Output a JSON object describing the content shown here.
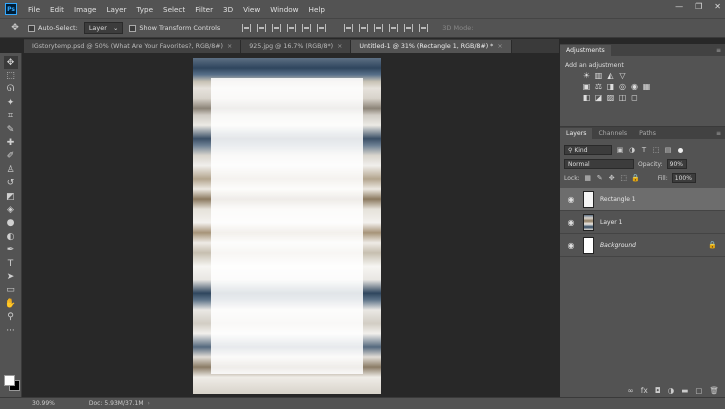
{
  "menubar": {
    "logo": "Ps",
    "items": [
      "File",
      "Edit",
      "Image",
      "Layer",
      "Type",
      "Select",
      "Filter",
      "3D",
      "View",
      "Window",
      "Help"
    ],
    "window_controls": [
      "—",
      "❐",
      "✕"
    ]
  },
  "options": {
    "auto_select_label": "Auto-Select:",
    "auto_select_value": "Layer",
    "transform_label": "Show Transform Controls",
    "mode_3d_label": "3D Mode:"
  },
  "tabs": [
    {
      "label": "IGstorytemp.psd @ 50% (What Are Your Favorites?, RGB/8#)",
      "active": false
    },
    {
      "label": "925.jpg @ 16.7% (RGB/8*)",
      "active": false
    },
    {
      "label": "Untitled-1 @ 31% (Rectangle 1, RGB/8#) *",
      "active": true
    }
  ],
  "tools": [
    {
      "icon": "move-tool-icon",
      "glyph": "✥"
    },
    {
      "icon": "marquee-tool-icon",
      "glyph": "⬚"
    },
    {
      "icon": "lasso-tool-icon",
      "glyph": "ᘏ"
    },
    {
      "icon": "magic-wand-icon",
      "glyph": "✦"
    },
    {
      "icon": "crop-tool-icon",
      "glyph": "⌗"
    },
    {
      "icon": "eyedropper-icon",
      "glyph": "✎"
    },
    {
      "icon": "healing-brush-icon",
      "glyph": "✚"
    },
    {
      "icon": "brush-tool-icon",
      "glyph": "✐"
    },
    {
      "icon": "clone-stamp-icon",
      "glyph": "♙"
    },
    {
      "icon": "history-brush-icon",
      "glyph": "↺"
    },
    {
      "icon": "eraser-icon",
      "glyph": "◩"
    },
    {
      "icon": "paint-bucket-icon",
      "glyph": "◈"
    },
    {
      "icon": "blur-tool-icon",
      "glyph": "●"
    },
    {
      "icon": "dodge-tool-icon",
      "glyph": "◐"
    },
    {
      "icon": "pen-tool-icon",
      "glyph": "✒"
    },
    {
      "icon": "type-tool-icon",
      "glyph": "T"
    },
    {
      "icon": "path-select-icon",
      "glyph": "➤"
    },
    {
      "icon": "shape-tool-icon",
      "glyph": "▭"
    },
    {
      "icon": "hand-tool-icon",
      "glyph": "✋"
    },
    {
      "icon": "zoom-tool-icon",
      "glyph": "⚲"
    },
    {
      "icon": "more-tools-icon",
      "glyph": "···"
    }
  ],
  "status": {
    "zoom": "30.99%",
    "doc_info": "Doc: 5.93M/37.1M",
    "arrow": "›"
  },
  "adjustments_panel": {
    "tabs": [
      "Adjustments"
    ],
    "title": "Add an adjustment",
    "row1": [
      "☀",
      "▥",
      "◭",
      "▽"
    ],
    "row2": [
      "▣",
      "⚖",
      "◨",
      "◎",
      "◉",
      "▦"
    ],
    "row3": [
      "◧",
      "◪",
      "▨",
      "◫",
      "◻"
    ]
  },
  "layers_panel": {
    "tabs": [
      "Layers",
      "Channels",
      "Paths"
    ],
    "kind_label": "Kind",
    "blend_mode": "Normal",
    "opacity_label": "Opacity:",
    "opacity_value": "90%",
    "lock_label": "Lock:",
    "fill_label": "Fill:",
    "fill_value": "100%",
    "layers": [
      {
        "name": "Rectangle 1",
        "selected": true,
        "thumb": "rect",
        "italic": false,
        "locked": false
      },
      {
        "name": "Layer 1",
        "selected": false,
        "thumb": "photo",
        "italic": false,
        "locked": false
      },
      {
        "name": "Background",
        "selected": false,
        "thumb": "white",
        "italic": true,
        "locked": true
      }
    ],
    "footer_icons": [
      "∞",
      "fx",
      "◘",
      "◑",
      "▬",
      "▢",
      "🗑"
    ]
  }
}
